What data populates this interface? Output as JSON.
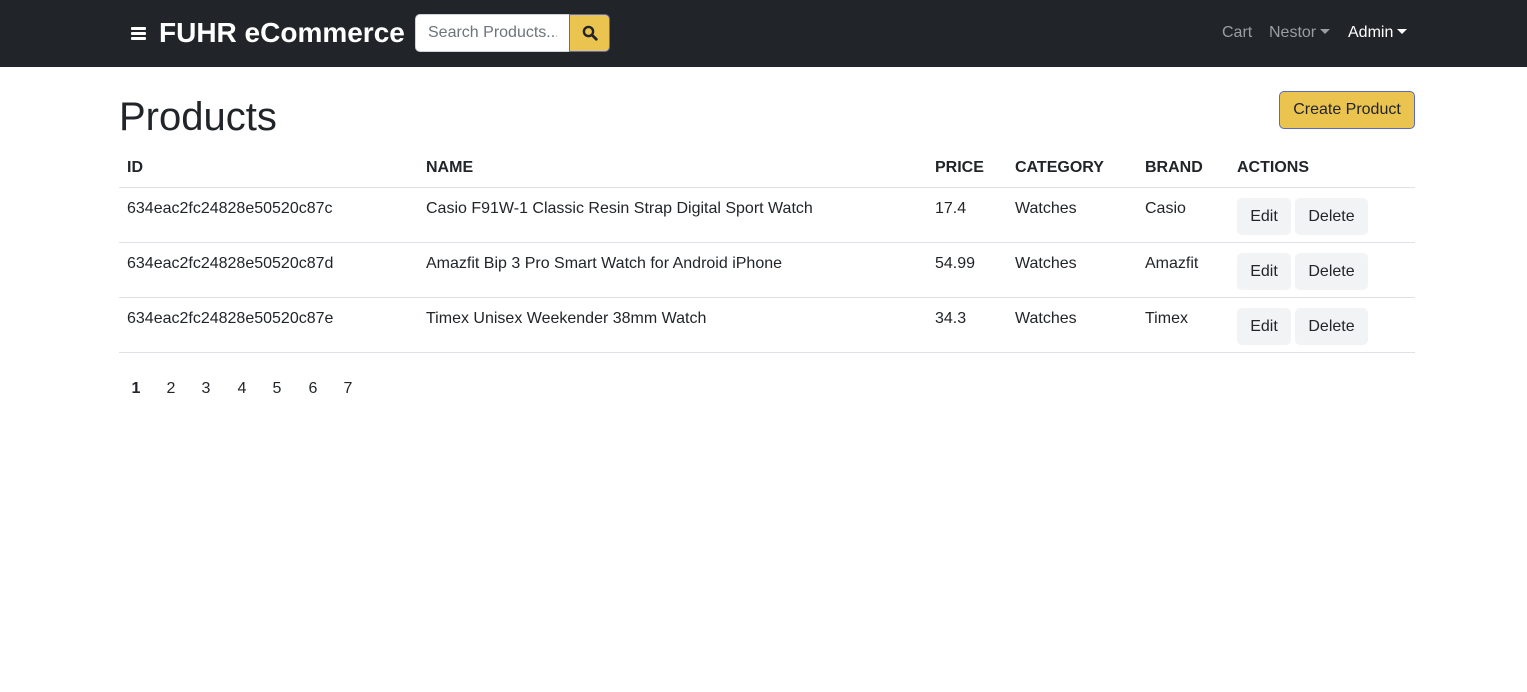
{
  "navbar": {
    "brand": "FUHR eCommerce",
    "search_placeholder": "Search Products...",
    "links": {
      "cart": "Cart",
      "user": "Nestor",
      "admin": "Admin"
    }
  },
  "page": {
    "title": "Products",
    "create_button": "Create Product"
  },
  "table": {
    "headers": [
      "ID",
      "NAME",
      "PRICE",
      "CATEGORY",
      "BRAND",
      "ACTIONS"
    ],
    "rows": [
      {
        "id": "634eac2fc24828e50520c87c",
        "name": "Casio F91W-1 Classic Resin Strap Digital Sport Watch",
        "price": "17.4",
        "category": "Watches",
        "brand": "Casio"
      },
      {
        "id": "634eac2fc24828e50520c87d",
        "name": "Amazfit Bip 3 Pro Smart Watch for Android iPhone",
        "price": "54.99",
        "category": "Watches",
        "brand": "Amazfit"
      },
      {
        "id": "634eac2fc24828e50520c87e",
        "name": "Timex Unisex Weekender 38mm Watch",
        "price": "34.3",
        "category": "Watches",
        "brand": "Timex"
      }
    ],
    "edit_label": "Edit",
    "delete_label": "Delete"
  },
  "pagination": {
    "pages": [
      "1",
      "2",
      "3",
      "4",
      "5",
      "6",
      "7"
    ],
    "current": "1"
  },
  "colors": {
    "navbar_bg": "#212529",
    "accent": "#ebc34f",
    "accent_border": "#5c6bc0",
    "light_button": "#f1f3f5"
  },
  "icons": {
    "menu": "hamburger-menu-icon",
    "search": "search-icon"
  }
}
